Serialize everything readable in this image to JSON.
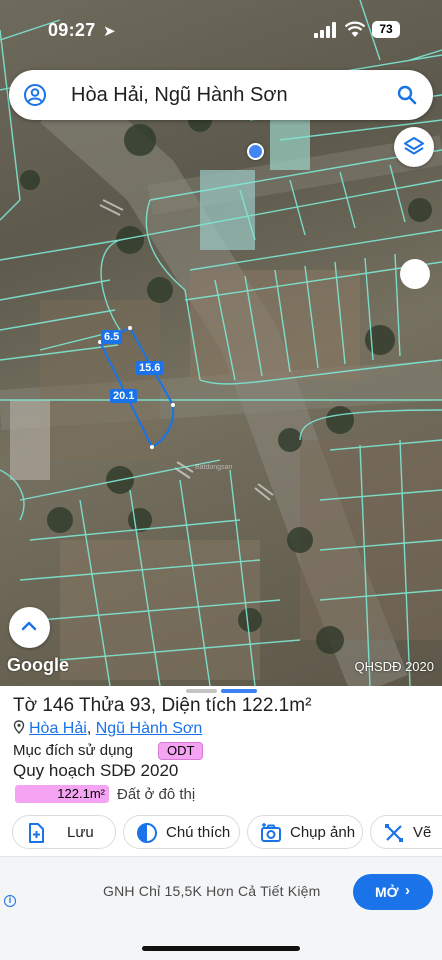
{
  "status_bar": {
    "time": "09:27",
    "battery": "73"
  },
  "search": {
    "query": "Hòa Hải, Ngũ Hành Sơn"
  },
  "map": {
    "attribution": "Google",
    "plan_layer": "QHSDĐ 2020",
    "watermark": "Batdongsan",
    "dimensions": [
      "6.5",
      "15.6",
      "20.1"
    ]
  },
  "parcel": {
    "sheet_label": "Tờ",
    "sheet_no": "146",
    "parcel_label": "Thửa",
    "parcel_no": "93",
    "area_text": ", Diện tích 122.1m²",
    "ward": "Hòa Hải",
    "sep": ",",
    "district": "Ngũ Hành Sơn",
    "purpose_label": "Mục đích sử dụng",
    "purpose_code": "ODT",
    "plan_title": "Quy hoạch SDĐ 2020",
    "plan_area": "122.1m²",
    "plan_land_type": "Đất ở đô thị"
  },
  "actions": [
    {
      "label": "Lưu",
      "icon": "save-icon"
    },
    {
      "label": "Chú thích",
      "icon": "legend-icon"
    },
    {
      "label": "Chụp ảnh",
      "icon": "camera-icon"
    },
    {
      "label": "Vẽ",
      "icon": "draw-icon"
    }
  ],
  "ad": {
    "text": "GNH Chỉ 15,5K Hơn Cả Tiết Kiệm",
    "cta": "MỞ",
    "cta_icon": "chevron-right-icon",
    "info_icon": "info-icon"
  },
  "colors": {
    "accent": "#1a73e8",
    "odt": "#f4a4f2",
    "parcel_line": "#7ee8d4"
  }
}
